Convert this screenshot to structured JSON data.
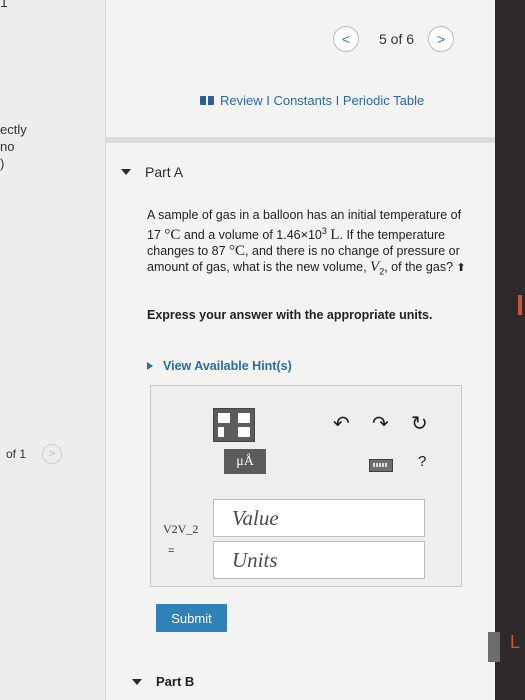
{
  "left_panel": {
    "top_fragment": "1",
    "fragment_1": "ectly",
    "fragment_2": "no",
    "fragment_3": ")",
    "of_label": "of 1"
  },
  "pager": {
    "label": "5 of 6",
    "prev_icon": "chevron-left-icon",
    "next_icon": "chevron-right-icon"
  },
  "header_links": "Review I Constants I Periodic Table",
  "part_a": {
    "title": "Part A",
    "question_1": "A sample of gas in a balloon has an initial temperature of 17",
    "unit_c": "°C",
    "question_2": "and a volume of 1.46×10",
    "exp": "3",
    "unit_l": "L",
    "question_3": ". If the temperature changes to 87",
    "question_4": ", and there is no change of pressure or amount of gas, what is the new volume,",
    "v2": "V",
    "v2_sub": "2",
    "question_5": ", of the gas?",
    "instruction": "Express your answer with the appropriate units.",
    "hint_link": "View Available Hint(s)"
  },
  "answer": {
    "mu_button": "μÅ",
    "help": "?",
    "var_label": "V2V_2",
    "eq": "=",
    "value_placeholder": "Value",
    "units_placeholder": "Units"
  },
  "submit_label": "Submit",
  "part_b": {
    "title": "Part B"
  },
  "colors": {
    "accent": "#2f82b6",
    "link": "#2b6aa8",
    "background": "#f3f3f1"
  }
}
